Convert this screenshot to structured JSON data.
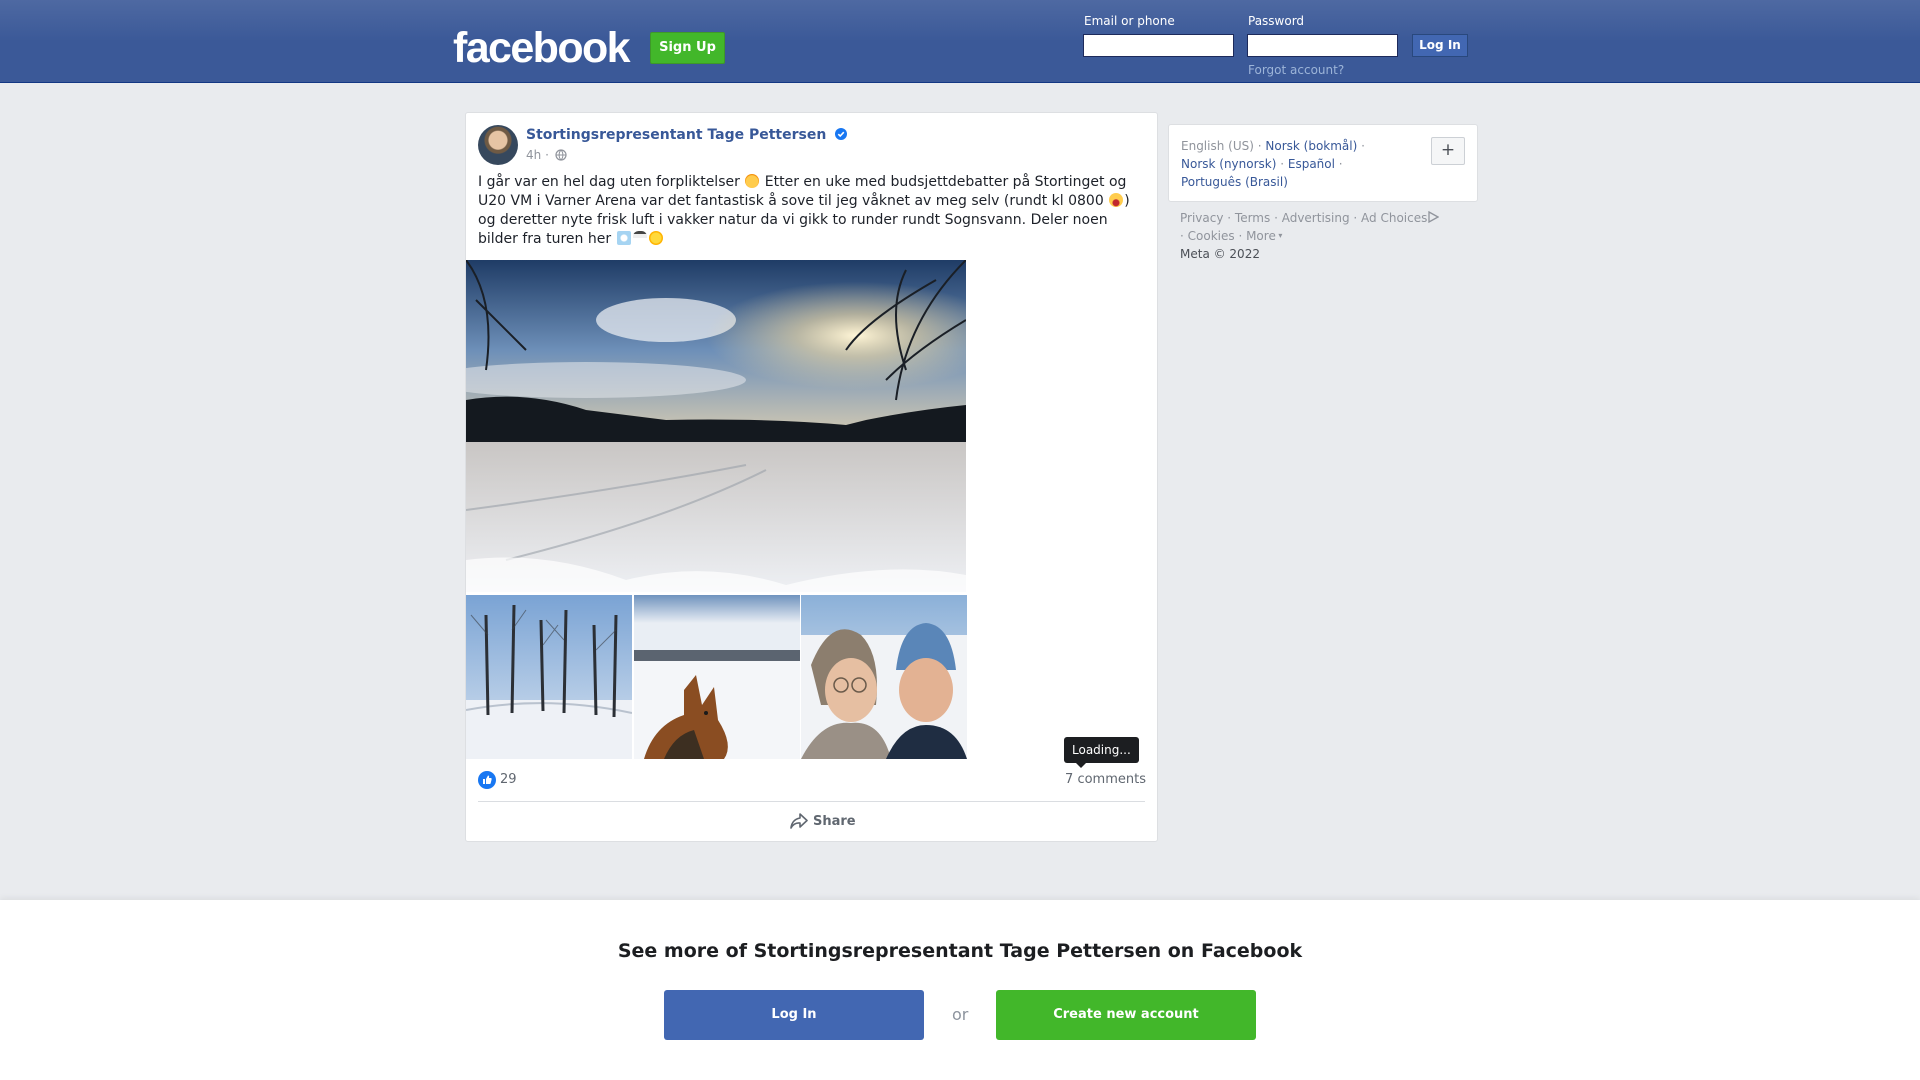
{
  "header": {
    "logo": "facebook",
    "signup_label": "Sign Up",
    "email_label": "Email or phone",
    "password_label": "Password",
    "login_label": "Log In",
    "forgot_label": "Forgot account?",
    "email_value": "",
    "password_value": ""
  },
  "post": {
    "author": "Stortingsrepresentant Tage Pettersen",
    "verified": true,
    "time": "4h",
    "visibility_icon": "globe-icon",
    "text_parts": [
      "I går var en hel dag uten forpliktelser",
      "Etter en uke med budsjettdebatter på Stortinget og U20 VM i Varner Arena var det fantastisk å sove til jeg våknet av meg selv (rundt kl 0800",
      ") og deretter nyte frisk luft i vakker natur da vi gikk to runder rundt Sognsvann. Deler noen bilder fra turen her"
    ],
    "emojis": [
      "partying-face-emoji",
      "laughing-emoji",
      "snowflake-emoji",
      "snowman-emoji",
      "sun-emoji"
    ],
    "photos": [
      "frozen-lake-sunset-photo",
      "snowy-birch-trees-photo",
      "dog-on-frozen-lake-photo",
      "couple-selfie-photo"
    ],
    "like_count": "29",
    "comments_label": "7 comments",
    "tooltip": "Loading...",
    "share_label": "Share"
  },
  "languages": {
    "current": "English (US)",
    "items": [
      "Norsk (bokmål)",
      "Norsk (nynorsk)",
      "Español",
      "Português (Brasil)"
    ],
    "add_label": "+"
  },
  "footer": {
    "links": [
      "Privacy",
      "Terms",
      "Advertising",
      "Ad Choices",
      "Cookies",
      "More"
    ],
    "copyright": "Meta © 2022"
  },
  "banner": {
    "title": "See more of Stortingsrepresentant Tage Pettersen on Facebook",
    "login_label": "Log In",
    "or_label": "or",
    "create_label": "Create new account"
  },
  "colors": {
    "brand_blue": "#3b5998",
    "button_blue": "#4267b2",
    "green": "#42b72a",
    "link": "#385898"
  }
}
